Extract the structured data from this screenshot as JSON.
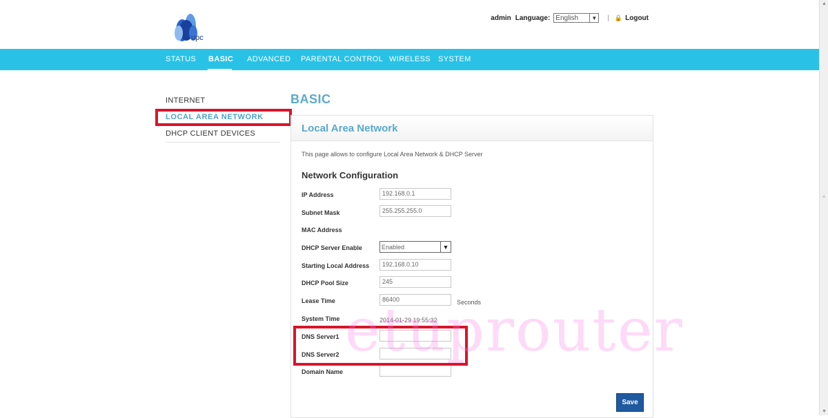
{
  "header": {
    "logo_text": "upc",
    "user": "admin",
    "language_label": "Language:",
    "language_value": "English",
    "logout_label": "Logout"
  },
  "nav": {
    "items": [
      {
        "label": "STATUS"
      },
      {
        "label": "BASIC"
      },
      {
        "label": "ADVANCED"
      },
      {
        "label": "PARENTAL CONTROL"
      },
      {
        "label": "WIRELESS"
      },
      {
        "label": "SYSTEM"
      }
    ],
    "active": "BASIC"
  },
  "sidebar": {
    "items": [
      {
        "label": "INTERNET"
      },
      {
        "label": "LOCAL AREA NETWORK"
      },
      {
        "label": "DHCP CLIENT DEVICES"
      }
    ],
    "active": "LOCAL AREA NETWORK"
  },
  "main": {
    "heading": "BASIC",
    "panel_title": "Local Area Network",
    "description": "This page allows to configure Local Area Network & DHCP Server",
    "section_title": "Network Configuration",
    "fields": {
      "ip_address": {
        "label": "IP Address",
        "value": "192.168.0.1"
      },
      "subnet_mask": {
        "label": "Subnet Mask",
        "value": "255.255.255.0"
      },
      "mac_address": {
        "label": "MAC Address",
        "value": ""
      },
      "dhcp_server_enable": {
        "label": "DHCP Server Enable",
        "value": "Enabled"
      },
      "starting_local_address": {
        "label": "Starting Local Address",
        "value": "192.168.0.10"
      },
      "dhcp_pool_size": {
        "label": "DHCP Pool Size",
        "value": "245"
      },
      "lease_time": {
        "label": "Lease Time",
        "value": "86400",
        "unit": "Seconds"
      },
      "system_time": {
        "label": "System Time",
        "value": "2014-01-29 19:55:32"
      },
      "dns_server1": {
        "label": "DNS Server1",
        "value": ""
      },
      "dns_server2": {
        "label": "DNS Server2",
        "value": ""
      },
      "domain_name": {
        "label": "Domain Name",
        "value": ""
      }
    },
    "save_label": "Save"
  },
  "watermark": "etuprouter",
  "colors": {
    "nav_bg": "#29c2e6",
    "accent_text": "#5aa9cf",
    "highlight_box": "#d9142a",
    "save_button": "#1f5aa0"
  }
}
